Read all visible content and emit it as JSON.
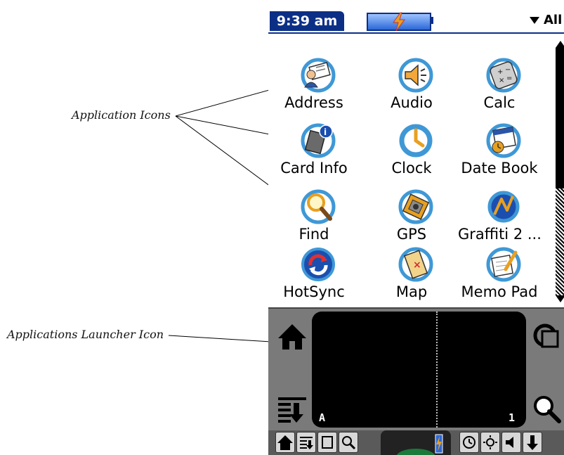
{
  "annotations": {
    "application_icons": "Application Icons",
    "launcher_icon": "Applications Launcher Icon"
  },
  "statusbar": {
    "time": "9:39 am",
    "category": "All"
  },
  "apps": [
    {
      "label": "Address",
      "icon": "address-icon"
    },
    {
      "label": "Audio",
      "icon": "audio-icon"
    },
    {
      "label": "Calc",
      "icon": "calc-icon"
    },
    {
      "label": "Card Info",
      "icon": "card-info-icon"
    },
    {
      "label": "Clock",
      "icon": "clock-icon"
    },
    {
      "label": "Date Book",
      "icon": "date-book-icon"
    },
    {
      "label": "Find",
      "icon": "find-icon"
    },
    {
      "label": "GPS",
      "icon": "gps-icon"
    },
    {
      "label": "Graffiti 2 ...",
      "icon": "graffiti-icon"
    },
    {
      "label": "HotSync",
      "icon": "hotsync-icon"
    },
    {
      "label": "Map",
      "icon": "map-icon"
    },
    {
      "label": "Memo Pad",
      "icon": "memo-pad-icon"
    }
  ],
  "graffiti": {
    "left_label": "A",
    "right_label": "1"
  },
  "colors": {
    "title_bar": "#0c2f86",
    "icon_ring": "#3f98d6",
    "graffiti_bg": "#7a7a7a"
  }
}
